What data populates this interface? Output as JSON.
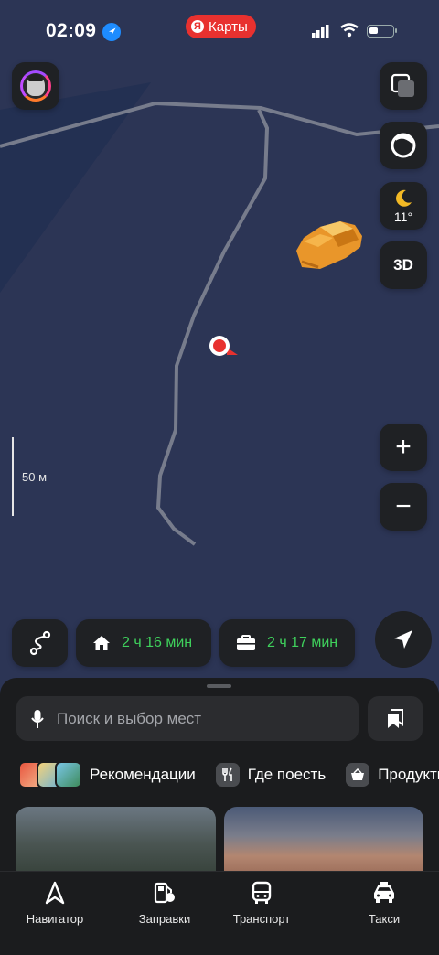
{
  "status_bar": {
    "time": "02:09",
    "app_pill": "Карты",
    "app_pill_logo": "Я"
  },
  "map": {
    "scale_label": "50 м",
    "weather_temp": "11°",
    "three_d_label": "3D",
    "zoom_in_label": "+",
    "zoom_out_label": "−"
  },
  "quick_routes": {
    "home_time": "2 ч 16 мин",
    "work_time": "2 ч 17 мин",
    "accent": "#3fd15c"
  },
  "sheet": {
    "search_placeholder": "Поиск и выбор мест",
    "categories": [
      {
        "label": "Рекомендации"
      },
      {
        "label": "Где поесть"
      },
      {
        "label": "Продукты"
      }
    ]
  },
  "tabbar": {
    "items": [
      {
        "label": "Навигатор",
        "icon": "navigator-icon"
      },
      {
        "label": "Заправки",
        "icon": "fuel-icon"
      },
      {
        "label": "Транспорт",
        "icon": "bus-icon"
      },
      {
        "label": "Такси",
        "icon": "taxi-icon"
      }
    ]
  },
  "colors": {
    "map_bg": "#2c3555",
    "panel": "#1f2124",
    "brand_red": "#e8312f"
  }
}
